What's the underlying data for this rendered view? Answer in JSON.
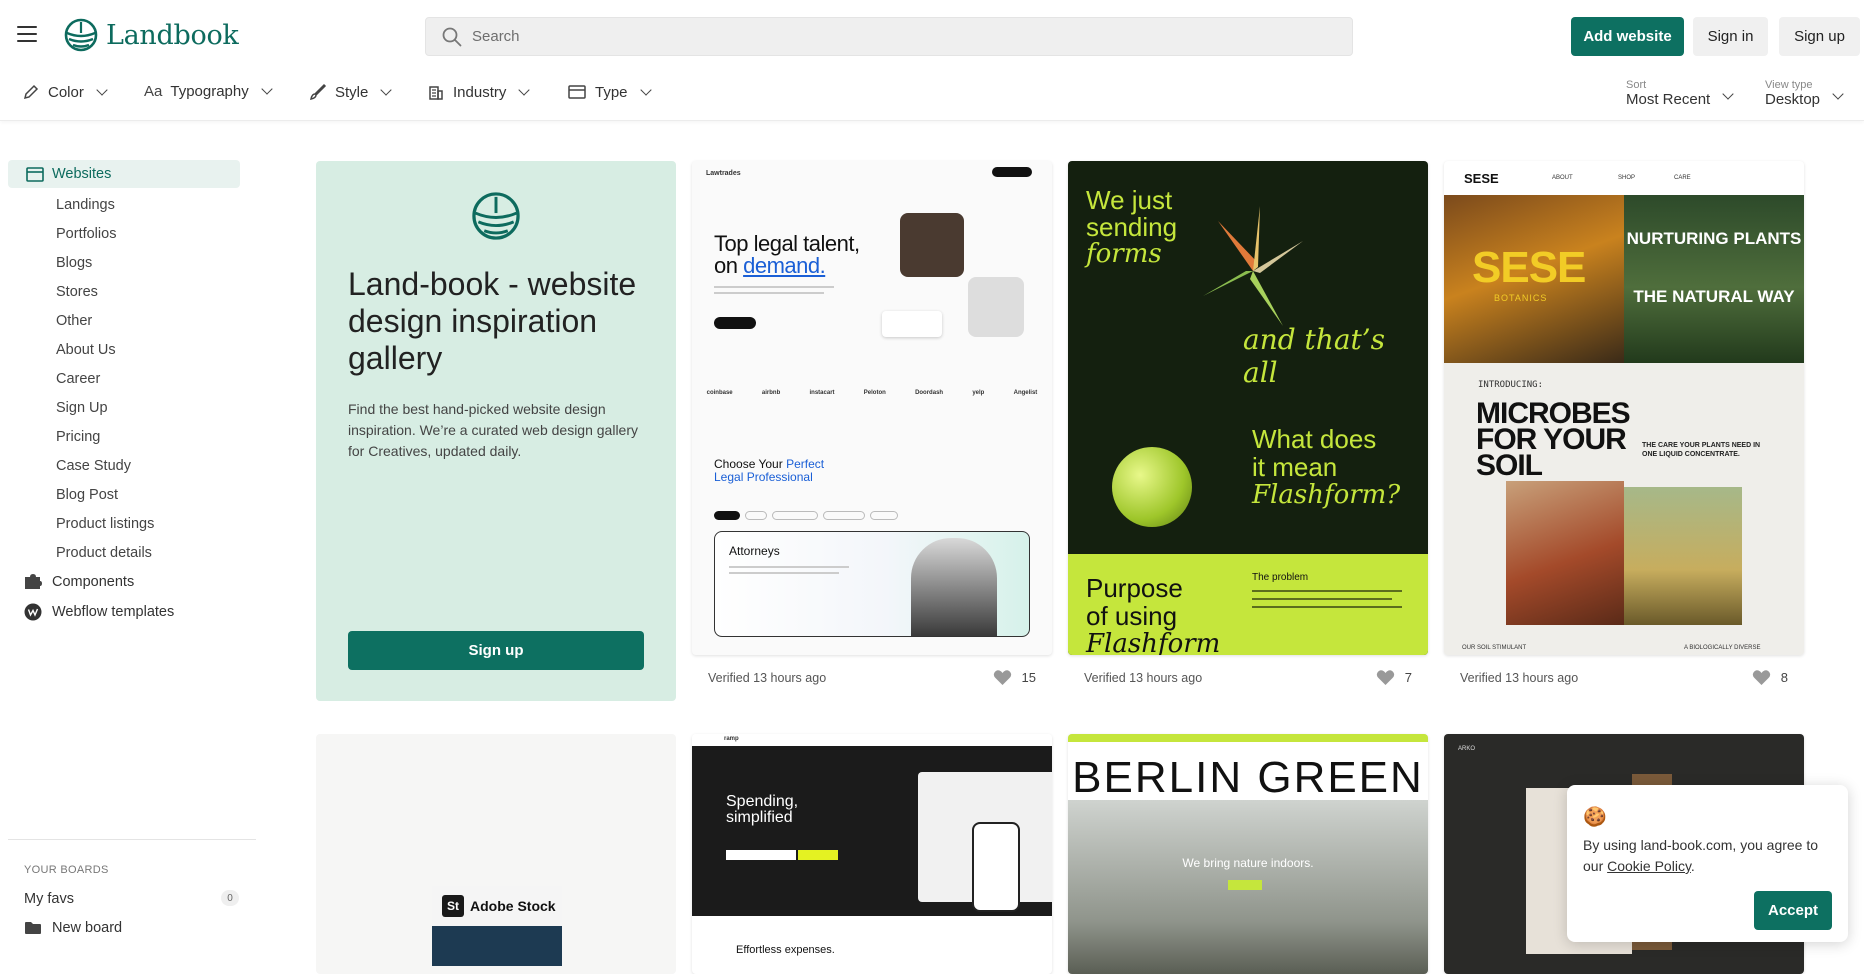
{
  "header": {
    "logo_text": "Landbook",
    "search_placeholder": "Search",
    "add_website": "Add website",
    "sign_in": "Sign in",
    "sign_up": "Sign up"
  },
  "filters": {
    "color": "Color",
    "typography": "Typography",
    "style": "Style",
    "industry": "Industry",
    "type": "Type",
    "sort_label": "Sort",
    "sort_value": "Most Recent",
    "view_label": "View type",
    "view_value": "Desktop"
  },
  "sidebar": {
    "main": "Websites",
    "items": [
      "Landings",
      "Portfolios",
      "Blogs",
      "Stores",
      "Other",
      "About Us",
      "Career",
      "Sign Up",
      "Pricing",
      "Case Study",
      "Blog Post",
      "Product listings",
      "Product details"
    ],
    "components": "Components",
    "webflow": "Webflow templates",
    "boards_title": "YOUR BOARDS",
    "my_favs": "My favs",
    "my_favs_count": "0",
    "new_board": "New board"
  },
  "promo": {
    "title": "Land-book - website design inspiration gallery",
    "description": "Find the best hand-picked website design inspiration. We’re a curated web design gallery for Creatives, updated daily.",
    "button": "Sign up"
  },
  "cards": [
    {
      "verified": "Verified 13 hours ago",
      "likes": "15"
    },
    {
      "verified": "Verified 13 hours ago",
      "likes": "7"
    },
    {
      "verified": "Verified 13 hours ago",
      "likes": "8"
    }
  ],
  "shots": {
    "lawtrades": {
      "brand": "Lawtrades",
      "hero_line1": "Top legal talent,",
      "hero_line2_a": "on ",
      "hero_line2_b": "demand.",
      "logos": [
        "coinbase",
        "airbnb",
        "instacart",
        "Peloton",
        "Doordash",
        "yelp",
        "Angelist"
      ],
      "choose_a": "Choose Your ",
      "choose_b": "Perfect",
      "choose_c": "Legal Professional",
      "attorneys": "Attorneys"
    },
    "flashform": {
      "line1": "We just",
      "line2": "sending",
      "line3": "forms",
      "tagline": "and that’s all",
      "q1": "What does",
      "q2": "it mean",
      "q3": "Flashform?",
      "purpose1": "Purpose",
      "purpose2": "of using",
      "purpose3": "Flashform",
      "problem": "The problem"
    },
    "sese": {
      "brand": "SESE",
      "nav": [
        "ABOUT",
        "SHOP",
        "CARE"
      ],
      "bottle_label": "SESE",
      "botanics": "BOTANICS",
      "nurturing": "NURTURING PLANTS",
      "natural": "THE NATURAL WAY",
      "introducing": "INTRODUCING:",
      "microbes": "MICROBES FOR YOUR SOIL",
      "care": "THE CARE YOUR PLANTS NEED IN ONE LIQUID CONCENTRATE.",
      "footer_left": "OUR SOIL STIMULANT",
      "footer_right": "A BIOLOGICALLY DIVERSE"
    },
    "adobe": {
      "label": "Adobe Stock",
      "mark": "St"
    },
    "ramp": {
      "brand": "ramp",
      "headline1": "Spending,",
      "headline2": "simplified",
      "sub": "Effortless expenses."
    },
    "berlin": {
      "title": "BERLIN GREEN",
      "caption": "We bring nature indoors."
    },
    "arko": {
      "brand": "ARKO"
    }
  },
  "cookie": {
    "emoji": "🍪",
    "text": "By using land-book.com, you agree to our ",
    "link": "Cookie Policy",
    "end": ".",
    "accept": "Accept"
  },
  "colors": {
    "brand": "#0d7061",
    "promo_bg": "#d7ede3",
    "active_bg": "#e8f2ef",
    "flash_green": "#c5e63c"
  }
}
